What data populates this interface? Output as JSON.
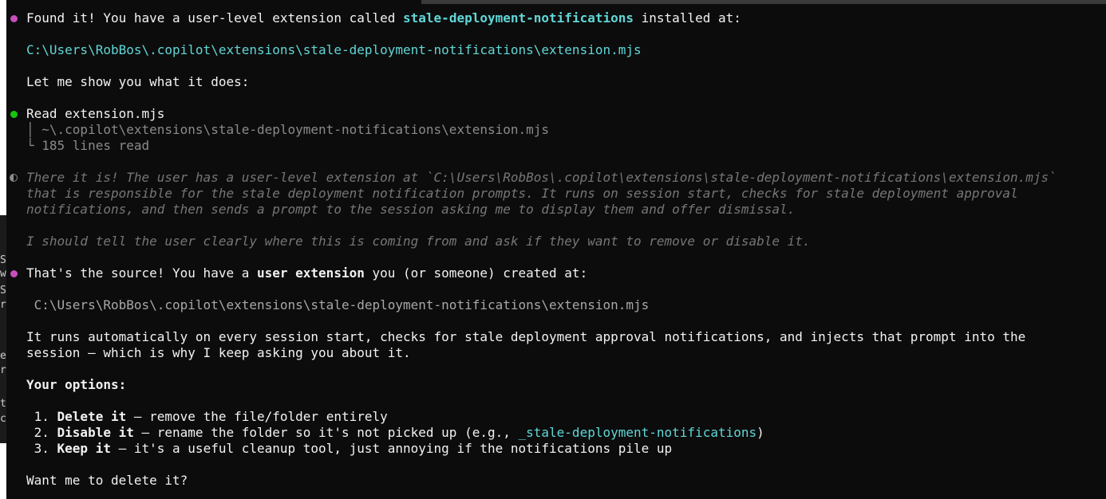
{
  "left_edge_glyphs": [
    "S",
    "w",
    "S",
    "r",
    "e",
    "r",
    "t",
    "c"
  ],
  "messages": {
    "found": {
      "prefix": "Found it! You have a user-level extension called ",
      "name": "stale-deployment-notifications",
      "suffix": " installed at:"
    },
    "path1": "C:\\Users\\RobBos\\.copilot\\extensions\\stale-deployment-notifications\\extension.mjs",
    "show": "Let me show you what it does:",
    "read_tool": {
      "verb": "Read",
      "file": " extension.mjs",
      "tree_line1": "│ ~\\.copilot\\extensions\\stale-deployment-notifications\\extension.mjs",
      "tree_line2": "└ 185 lines read"
    },
    "thinking": {
      "line1": "There it is! The user has a user-level extension at `C:\\Users\\RobBos\\.copilot\\extensions\\stale-deployment-notifications\\extension.mjs`",
      "line2": "that is responsible for the stale deployment notification prompts. It runs on session start, checks for stale deployment approval",
      "line3": "notifications, and then sends a prompt to the session asking me to display them and offer dismissal.",
      "line4": "I should tell the user clearly where this is coming from and ask if they want to remove or disable it."
    },
    "source": {
      "prefix": "That's the source! You have a ",
      "bold": "user extension",
      "suffix": " you (or someone) created at:"
    },
    "path2": " C:\\Users\\RobBos\\.copilot\\extensions\\stale-deployment-notifications\\extension.mjs",
    "runs_line1": "It runs automatically on every session start, checks for stale deployment approval notifications, and injects that prompt into the",
    "runs_line2": "session — which is why I keep asking you about it.",
    "options_heading": "Your options:",
    "options": [
      {
        "num": " 1. ",
        "title": "Delete it",
        "desc": " — remove the file/folder entirely",
        "code": "",
        "tail": ""
      },
      {
        "num": " 2. ",
        "title": "Disable it",
        "desc": " — rename the folder so it's not picked up (e.g., ",
        "code": "_stale-deployment-notifications",
        "tail": ")"
      },
      {
        "num": " 3. ",
        "title": "Keep it",
        "desc": " — it's a useful cleanup tool, just annoying if the notifications pile up",
        "code": "",
        "tail": ""
      }
    ],
    "question": "Want me to delete it?"
  },
  "colors": {
    "background": "#0c0c0c",
    "text": "#cccccc",
    "accent_cyan": "#61d6d6",
    "bullet_magenta": "#c64fbd",
    "bullet_green": "#16c60c",
    "thinking_gray": "#767676"
  }
}
